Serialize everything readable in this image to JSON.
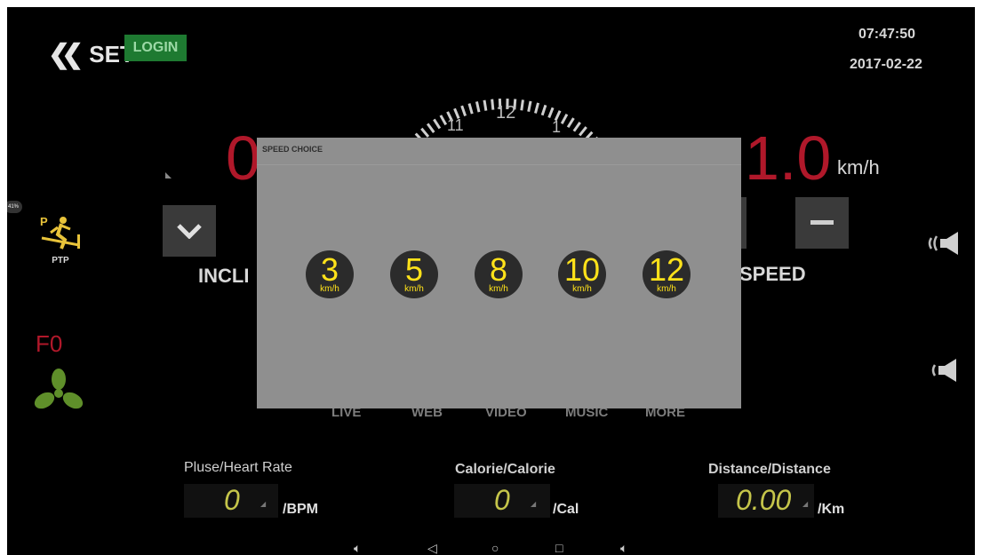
{
  "header": {
    "set_label": "SET",
    "login_label": "LOGIN",
    "time": "07:47:50",
    "date": "2017-02-22"
  },
  "dial": {
    "numbers": [
      "11",
      "12",
      "1"
    ]
  },
  "incline": {
    "value": "0",
    "label": "INCLI"
  },
  "speed": {
    "value": "1.0",
    "unit": "km/h",
    "label": "SPEED"
  },
  "left_panel": {
    "battery": "41%",
    "ptp_label": "PTP",
    "fan_label": "F0"
  },
  "bottom_nav": [
    "LIVE",
    "WEB",
    "VIDEO",
    "MUSIC",
    "MORE"
  ],
  "stats": {
    "heart": {
      "label": "Pluse/Heart Rate",
      "value": "0",
      "unit": "/BPM"
    },
    "calorie": {
      "label": "Calorie/Calorie",
      "value": "0",
      "unit": "/Cal"
    },
    "distance": {
      "label": "Distance/Distance",
      "value": "0.00",
      "unit": "/Km"
    }
  },
  "dialog": {
    "title": "SPEED CHOICE",
    "options": [
      {
        "value": "3",
        "unit": "km/h"
      },
      {
        "value": "5",
        "unit": "km/h"
      },
      {
        "value": "8",
        "unit": "km/h"
      },
      {
        "value": "10",
        "unit": "km/h"
      },
      {
        "value": "12",
        "unit": "km/h"
      }
    ]
  },
  "colors": {
    "accent_red": "#b0182a",
    "chip_yellow": "#ffe21a",
    "login_green": "#1e7a31",
    "fan_green": "#5f8f2a",
    "ptp_yellow": "#e8c33a"
  },
  "icons": [
    "double-chevron-left-icon",
    "chevron-down-icon",
    "minus-icon",
    "treadmill-ptp-icon",
    "fan-icon",
    "volume-up-icon",
    "volume-down-icon",
    "back-icon",
    "home-icon",
    "recents-icon",
    "volume-icon"
  ]
}
